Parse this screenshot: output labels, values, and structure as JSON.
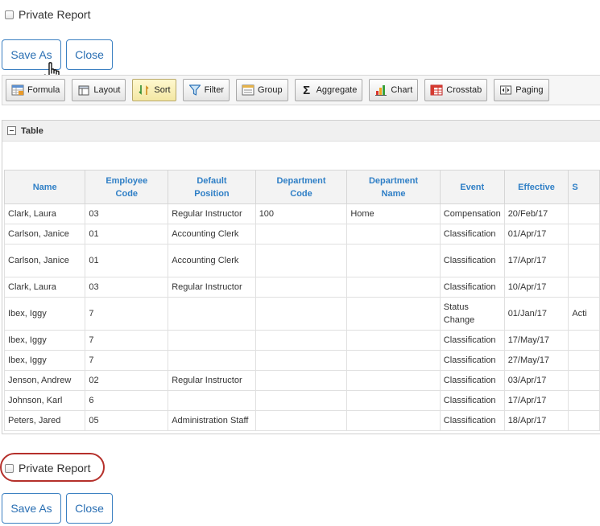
{
  "private_report": {
    "label": "Private Report"
  },
  "buttons": {
    "save_as": "Save As",
    "close": "Close"
  },
  "toolbar": {
    "items": [
      {
        "label": "Formula",
        "icon": "formula-icon"
      },
      {
        "label": "Layout",
        "icon": "layout-icon"
      },
      {
        "label": "Sort",
        "icon": "sort-icon",
        "active": true
      },
      {
        "label": "Filter",
        "icon": "filter-icon"
      },
      {
        "label": "Group",
        "icon": "group-icon"
      },
      {
        "label": "Aggregate",
        "icon": "sigma-icon",
        "glyph": "Σ"
      },
      {
        "label": "Chart",
        "icon": "chart-icon"
      },
      {
        "label": "Crosstab",
        "icon": "crosstab-icon"
      },
      {
        "label": "Paging",
        "icon": "paging-icon"
      }
    ]
  },
  "panel": {
    "title": "Table"
  },
  "table": {
    "columns": [
      [
        "Name"
      ],
      [
        "Employee",
        "Code"
      ],
      [
        "Default",
        "Position"
      ],
      [
        "Department",
        "Code"
      ],
      [
        "Department",
        "Name"
      ],
      [
        "Event"
      ],
      [
        "Effective"
      ],
      [
        "S"
      ]
    ],
    "rows": [
      {
        "name": "Clark, Laura",
        "employee_code": "03",
        "default_position": "Regular Instructor",
        "department_code": "100",
        "department_name": "Home",
        "event": "Compensation",
        "effective": "20/Feb/17",
        "status": ""
      },
      {
        "name": "Carlson, Janice",
        "employee_code": "01",
        "default_position": "Accounting Clerk",
        "department_code": "",
        "department_name": "",
        "event": "Classification",
        "effective": "01/Apr/17",
        "status": ""
      },
      {
        "name": "Carlson, Janice",
        "employee_code": "01",
        "default_position": "Accounting Clerk",
        "department_code": "",
        "department_name": "",
        "event": "Classification",
        "effective": "17/Apr/17",
        "status": ""
      },
      {
        "name": "Clark, Laura",
        "employee_code": "03",
        "default_position": "Regular Instructor",
        "department_code": "",
        "department_name": "",
        "event": "Classification",
        "effective": "10/Apr/17",
        "status": ""
      },
      {
        "name": "Ibex, Iggy",
        "employee_code": "7",
        "default_position": "",
        "department_code": "",
        "department_name": "",
        "event": "Status Change",
        "effective": "01/Jan/17",
        "status": "Acti"
      },
      {
        "name": "Ibex, Iggy",
        "employee_code": "7",
        "default_position": "",
        "department_code": "",
        "department_name": "",
        "event": "Classification",
        "effective": "17/May/17",
        "status": ""
      },
      {
        "name": "Ibex, Iggy",
        "employee_code": "7",
        "default_position": "",
        "department_code": "",
        "department_name": "",
        "event": "Classification",
        "effective": "27/May/17",
        "status": ""
      },
      {
        "name": "Jenson, Andrew",
        "employee_code": "02",
        "default_position": "Regular Instructor",
        "department_code": "",
        "department_name": "",
        "event": "Classification",
        "effective": "03/Apr/17",
        "status": ""
      },
      {
        "name": "Johnson, Karl",
        "employee_code": "6",
        "default_position": "",
        "department_code": "",
        "department_name": "",
        "event": "Classification",
        "effective": "17/Apr/17",
        "status": ""
      },
      {
        "name": "Peters, Jared",
        "employee_code": "05",
        "default_position": "Administration Staff",
        "department_code": "",
        "department_name": "",
        "event": "Classification",
        "effective": "18/Apr/17",
        "status": ""
      }
    ]
  }
}
